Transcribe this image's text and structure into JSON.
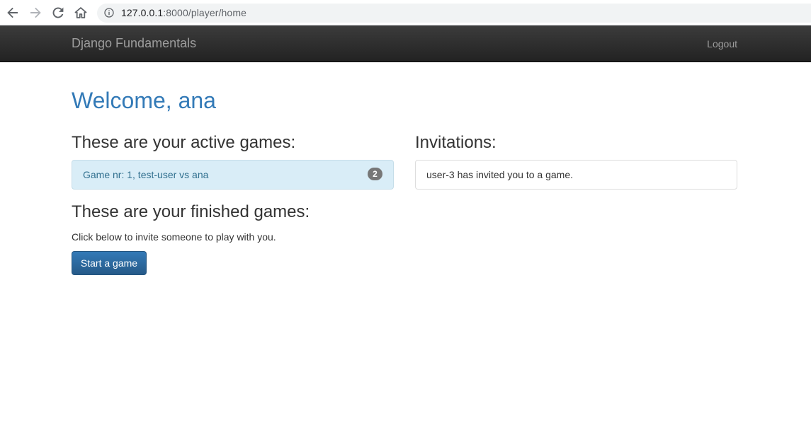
{
  "browser": {
    "url_host": "127.0.0.1",
    "url_rest": ":8000/player/home",
    "icons": [
      "back-arrow-icon",
      "forward-arrow-icon",
      "reload-icon",
      "home-icon",
      "info-icon"
    ]
  },
  "navbar": {
    "brand": "Django Fundamentals",
    "logout": "Logout"
  },
  "main": {
    "welcome": "Welcome, ana",
    "active_games_heading": "These are your active games:",
    "active_games": [
      {
        "label": "Game nr: 1, test-user vs ana",
        "badge": "2"
      }
    ],
    "invitations_heading": "Invitations:",
    "invitations": [
      {
        "label": "user-3 has invited you to a game."
      }
    ],
    "finished_games_heading": "These are your finished games:",
    "invite_hint": "Click below to invite someone to play with you.",
    "start_button": "Start a game"
  },
  "colors": {
    "link_blue": "#337ab7",
    "navbar_dark": "#222222",
    "info_bg": "#d9edf7",
    "badge_gray": "#777777"
  }
}
